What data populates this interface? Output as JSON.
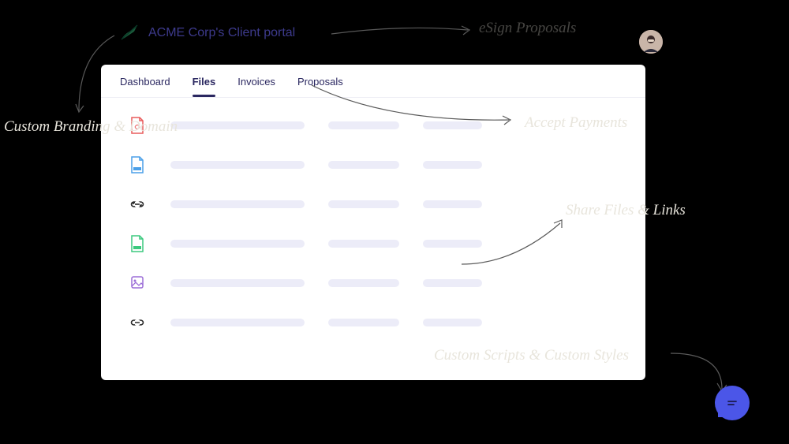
{
  "header": {
    "portal_title": "ACME Corp's Client portal"
  },
  "tabs": [
    {
      "label": "Dashboard",
      "active": false
    },
    {
      "label": "Files",
      "active": true
    },
    {
      "label": "Invoices",
      "active": false
    },
    {
      "label": "Proposals",
      "active": false
    }
  ],
  "file_rows": [
    {
      "icon": "pdf",
      "color": "#E95B5B"
    },
    {
      "icon": "doc",
      "color": "#4A9FE8"
    },
    {
      "icon": "link",
      "color": "#2a2a2a"
    },
    {
      "icon": "sheet",
      "color": "#3BC97E"
    },
    {
      "icon": "image",
      "color": "#9B6DD7"
    },
    {
      "icon": "link",
      "color": "#2a2a2a"
    }
  ],
  "annotations": {
    "branding": "Custom Branding & Domain",
    "esign": "eSign Proposals",
    "payments": "Accept Payments",
    "files": "Share Files & Links",
    "scripts": "Custom Scripts & Custom Styles"
  }
}
